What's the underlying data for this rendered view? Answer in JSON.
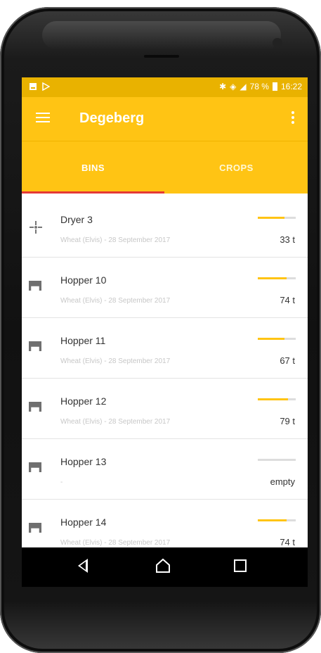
{
  "status_bar": {
    "battery_percent": "78 %",
    "time": "16:22"
  },
  "app_bar": {
    "title": "Degeberg",
    "menu_icon": "hamburger-menu-icon",
    "overflow_icon": "more-vert-icon"
  },
  "tabs": [
    {
      "label": "BINS",
      "selected": true
    },
    {
      "label": "CROPS",
      "selected": false
    }
  ],
  "colors": {
    "primary": "#FFC414",
    "status_bar": "#E9B200",
    "tab_indicator": "#E53935"
  },
  "bins": [
    {
      "name": "Dryer 3",
      "details": "Wheat (Elvis) - 28 September 2017",
      "amount": "33 t",
      "fill": 0.7,
      "icon": "dryer-fan-icon"
    },
    {
      "name": "Hopper 10",
      "details": "Wheat (Elvis) - 28 September 2017",
      "amount": "74 t",
      "fill": 0.75,
      "icon": "hopper-bin-icon"
    },
    {
      "name": "Hopper 11",
      "details": "Wheat (Elvis) - 28 September 2017",
      "amount": "67 t",
      "fill": 0.7,
      "icon": "hopper-bin-icon"
    },
    {
      "name": "Hopper 12",
      "details": "Wheat (Elvis) - 28 September 2017",
      "amount": "79 t",
      "fill": 0.8,
      "icon": "hopper-bin-icon"
    },
    {
      "name": "Hopper 13",
      "details": "-",
      "amount": "empty",
      "fill": 0.0,
      "icon": "hopper-bin-icon"
    },
    {
      "name": "Hopper 14",
      "details": "Wheat (Elvis) - 28 September 2017",
      "amount": "74 t",
      "fill": 0.75,
      "icon": "hopper-bin-icon"
    }
  ]
}
